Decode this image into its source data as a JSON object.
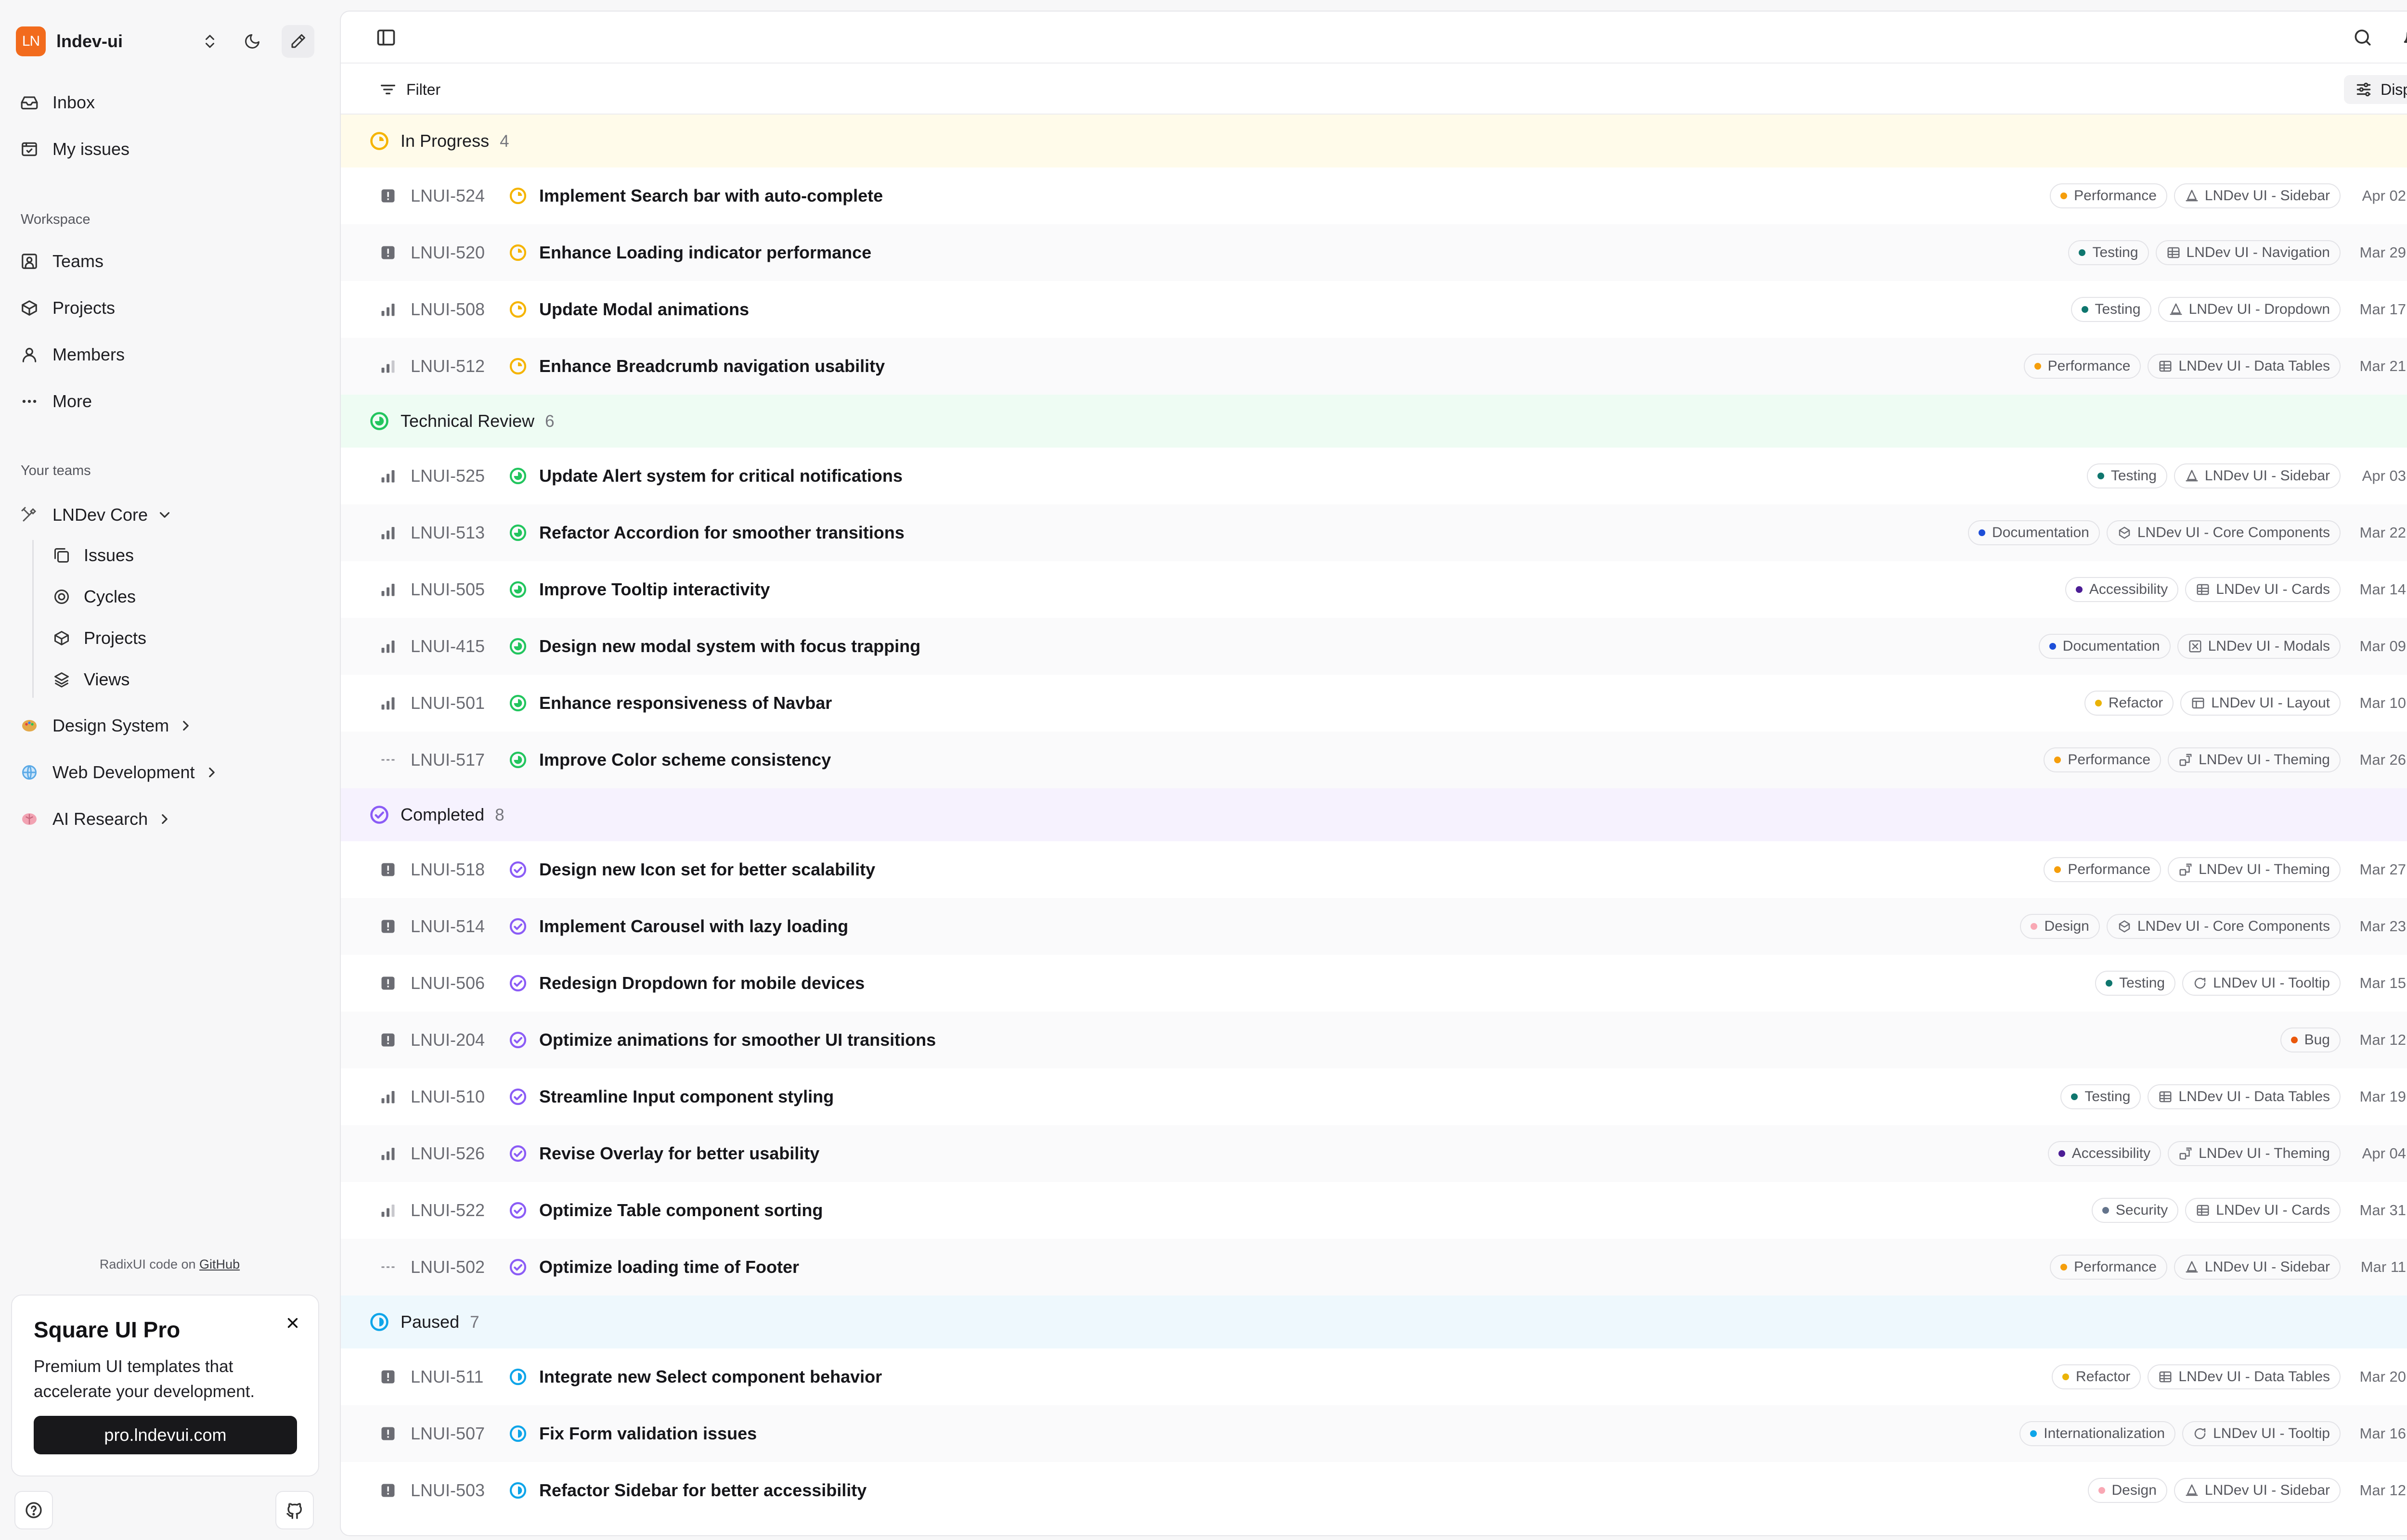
{
  "workspace": {
    "logo": "LN",
    "name": "lndev-ui"
  },
  "nav": {
    "inbox": "Inbox",
    "my_issues": "My issues"
  },
  "workspace_section": {
    "label": "Workspace",
    "items": [
      "Teams",
      "Projects",
      "Members",
      "More"
    ]
  },
  "teams_section": {
    "label": "Your teams",
    "teams": [
      "LNDev Core",
      "Design System",
      "Web Development",
      "AI Research"
    ],
    "core_sub": [
      "Issues",
      "Cycles",
      "Projects",
      "Views"
    ]
  },
  "footer": {
    "note_prefix": "RadixUI code on",
    "note_link": "GitHub",
    "promo_title": "Square UI Pro",
    "promo_text": "Premium UI templates that accelerate your development.",
    "promo_button": "pro.lndevui.com"
  },
  "toolbar": {
    "filter": "Filter",
    "display": "Display"
  },
  "colors": {
    "in_progress": "#f5b400",
    "technical_review": "#22c55e",
    "completed": "#8b5cf6",
    "paused": "#0ea5e9"
  },
  "groups": [
    {
      "name": "In Progress",
      "count": "4",
      "status": "in-progress",
      "issues": [
        {
          "id": "LNUI-524",
          "title": "Implement Search bar with auto-complete",
          "prio": "urgent",
          "label": "Performance",
          "labelColor": "#f59e0b",
          "project": "LNDev UI - Sidebar",
          "projIcon": "cone",
          "date": "Apr 02",
          "avatar": "purple",
          "st": "#22c55e"
        },
        {
          "id": "LNUI-520",
          "title": "Enhance Loading indicator performance",
          "prio": "urgent",
          "label": "Testing",
          "labelColor": "#0f766e",
          "project": "LNDev UI - Navigation",
          "projIcon": "grid",
          "date": "Mar 29",
          "avatar": "purple",
          "st": "#22c55e"
        },
        {
          "id": "LNUI-508",
          "title": "Update Modal animations",
          "prio": "high",
          "label": "Testing",
          "labelColor": "#0f766e",
          "project": "LNDev UI - Dropdown",
          "projIcon": "cone",
          "date": "Mar 17",
          "avatar": "pink",
          "st": "#9ca3af"
        },
        {
          "id": "LNUI-512",
          "title": "Enhance Breadcrumb navigation usability",
          "prio": "medium",
          "label": "Performance",
          "labelColor": "#f59e0b",
          "project": "LNDev UI - Data Tables",
          "projIcon": "grid",
          "date": "Mar 21",
          "avatar": "green",
          "st": "#22c55e"
        }
      ]
    },
    {
      "name": "Technical Review",
      "count": "6",
      "status": "technical-review",
      "issues": [
        {
          "id": "LNUI-525",
          "title": "Update Alert system for critical notifications",
          "prio": "high",
          "label": "Testing",
          "labelColor": "#0f766e",
          "project": "LNDev UI - Sidebar",
          "projIcon": "cone",
          "date": "Apr 03",
          "avatar": "none",
          "st": ""
        },
        {
          "id": "LNUI-513",
          "title": "Refactor Accordion for smoother transitions",
          "prio": "high",
          "label": "Documentation",
          "labelColor": "#1d4ed8",
          "project": "LNDev UI - Core Components",
          "projIcon": "cube",
          "date": "Mar 22",
          "avatar": "none",
          "st": ""
        },
        {
          "id": "LNUI-505",
          "title": "Improve Tooltip interactivity",
          "prio": "high",
          "label": "Accessibility",
          "labelColor": "#4c1d95",
          "project": "LNDev UI - Cards",
          "projIcon": "grid",
          "date": "Mar 14",
          "avatar": "lime",
          "st": "#f59e0b"
        },
        {
          "id": "LNUI-415",
          "title": "Design new modal system with focus trapping",
          "prio": "high",
          "label": "Documentation",
          "labelColor": "#1d4ed8",
          "project": "LNDev UI - Modals",
          "projIcon": "x-box",
          "date": "Mar 09",
          "avatar": "purple",
          "st": "#22c55e"
        },
        {
          "id": "LNUI-501",
          "title": "Enhance responsiveness of Navbar",
          "prio": "high",
          "label": "Refactor",
          "labelColor": "#eab308",
          "project": "LNDev UI - Layout",
          "projIcon": "layout",
          "date": "Mar 10",
          "avatar": "green",
          "st": "#22c55e"
        },
        {
          "id": "LNUI-517",
          "title": "Improve Color scheme consistency",
          "prio": "none",
          "label": "Performance",
          "labelColor": "#f59e0b",
          "project": "LNDev UI - Theming",
          "projIcon": "brush",
          "date": "Mar 26",
          "avatar": "green",
          "st": "#22c55e"
        }
      ]
    },
    {
      "name": "Completed",
      "count": "8",
      "status": "completed",
      "issues": [
        {
          "id": "LNUI-518",
          "title": "Design new Icon set for better scalability",
          "prio": "urgent",
          "label": "Performance",
          "labelColor": "#f59e0b",
          "project": "LNDev UI - Theming",
          "projIcon": "brush",
          "date": "Mar 27",
          "avatar": "green",
          "st": "#22c55e"
        },
        {
          "id": "LNUI-514",
          "title": "Implement Carousel with lazy loading",
          "prio": "urgent",
          "label": "Design",
          "labelColor": "#f9a8b4",
          "project": "LNDev UI - Core Components",
          "projIcon": "cube",
          "date": "Mar 23",
          "avatar": "pink",
          "st": "#9ca3af"
        },
        {
          "id": "LNUI-506",
          "title": "Redesign Dropdown for mobile devices",
          "prio": "urgent",
          "label": "Testing",
          "labelColor": "#0f766e",
          "project": "LNDev UI - Tooltip",
          "projIcon": "chat",
          "date": "Mar 15",
          "avatar": "pink",
          "st": "#9ca3af"
        },
        {
          "id": "LNUI-204",
          "title": "Optimize animations for smoother UI transitions",
          "prio": "urgent",
          "label": "Bug",
          "labelColor": "#ea580c",
          "project": "",
          "projIcon": "",
          "date": "Mar 12",
          "avatar": "pink",
          "st": "#9ca3af"
        },
        {
          "id": "LNUI-510",
          "title": "Streamline Input component styling",
          "prio": "high",
          "label": "Testing",
          "labelColor": "#0f766e",
          "project": "LNDev UI - Data Tables",
          "projIcon": "grid",
          "date": "Mar 19",
          "avatar": "lime",
          "st": "#9ca3af"
        },
        {
          "id": "LNUI-526",
          "title": "Revise Overlay for better usability",
          "prio": "high",
          "label": "Accessibility",
          "labelColor": "#4c1d95",
          "project": "LNDev UI - Theming",
          "projIcon": "brush",
          "date": "Apr 04",
          "avatar": "purple",
          "st": "#22c55e"
        },
        {
          "id": "LNUI-522",
          "title": "Optimize Table component sorting",
          "prio": "medium",
          "label": "Security",
          "labelColor": "#64748b",
          "project": "LNDev UI - Cards",
          "projIcon": "grid",
          "date": "Mar 31",
          "avatar": "pink",
          "st": "#9ca3af"
        },
        {
          "id": "LNUI-502",
          "title": "Optimize loading time of Footer",
          "prio": "none",
          "label": "Performance",
          "labelColor": "#f59e0b",
          "project": "LNDev UI - Sidebar",
          "projIcon": "cone",
          "date": "Mar 11",
          "avatar": "green",
          "st": "#22c55e"
        }
      ]
    },
    {
      "name": "Paused",
      "count": "7",
      "status": "paused",
      "issues": [
        {
          "id": "LNUI-511",
          "title": "Integrate new Select component behavior",
          "prio": "urgent",
          "label": "Refactor",
          "labelColor": "#eab308",
          "project": "LNDev UI - Data Tables",
          "projIcon": "grid",
          "date": "Mar 20",
          "avatar": "pink",
          "st": "#9ca3af"
        },
        {
          "id": "LNUI-507",
          "title": "Fix Form validation issues",
          "prio": "urgent",
          "label": "Internationalization",
          "labelColor": "#0ea5e9",
          "project": "LNDev UI - Tooltip",
          "projIcon": "chat",
          "date": "Mar 16",
          "avatar": "none",
          "st": ""
        },
        {
          "id": "LNUI-503",
          "title": "Refactor Sidebar for better accessibility",
          "prio": "urgent",
          "label": "Design",
          "labelColor": "#f9a8b4",
          "project": "LNDev UI - Sidebar",
          "projIcon": "cone",
          "date": "Mar 12",
          "avatar": "lime",
          "st": "#f59e0b"
        }
      ]
    }
  ]
}
